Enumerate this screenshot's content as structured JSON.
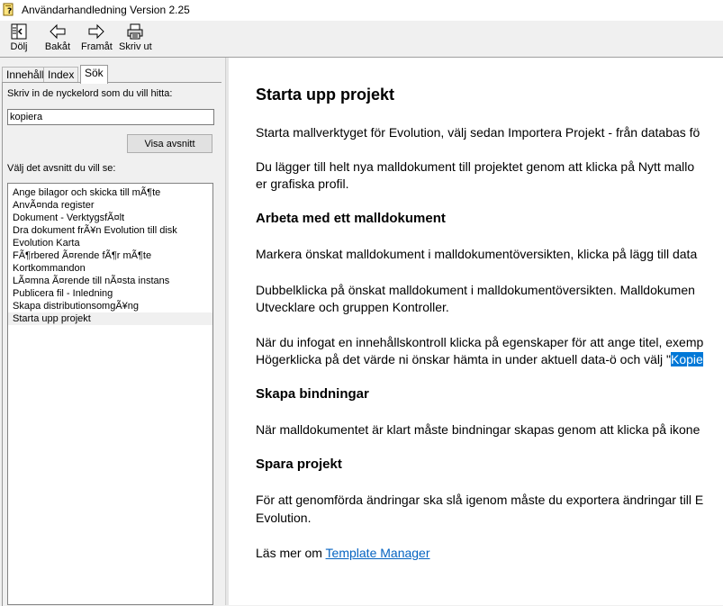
{
  "window": {
    "title": "Användarhandledning Version 2.25"
  },
  "toolbar": {
    "hide_label": "Dölj",
    "back_label": "Bakåt",
    "forward_label": "Framåt",
    "print_label": "Skriv ut"
  },
  "tabs": [
    {
      "label": "Innehåll"
    },
    {
      "label": "Index"
    },
    {
      "label": "Sök"
    }
  ],
  "search": {
    "prompt": "Skriv in de nyckelord som du vill hitta:",
    "value": "kopiera",
    "show_button": "Visa avsnitt",
    "select_prompt": "Välj det avsnitt du vill se:"
  },
  "topics": [
    "Ange bilagor och skicka till mÃ¶te",
    "AnvÃ¤nda register",
    "Dokument - VerktygsfÃ¤lt",
    "Dra dokument frÃ¥n Evolution till disk",
    "Evolution Karta",
    "FÃ¶rbered Ã¤rende fÃ¶r mÃ¶te",
    "Kortkommandon",
    "LÃ¤mna Ã¤rende till nÃ¤sta instans",
    "Publicera fil - Inledning",
    "Skapa distributionsomgÃ¥ng",
    "Starta upp projekt"
  ],
  "selected_topic": "Starta upp projekt",
  "article": {
    "title": "Starta upp projekt",
    "p1": "Starta mallverktyget för Evolution, välj sedan Importera Projekt - från databas fö",
    "p2a": "Du lägger till helt nya malldokument till projektet genom att klicka på Nytt mallo",
    "p2b": "er grafiska profil.",
    "h_arbeta": "Arbeta med ett malldokument",
    "p3": "Markera önskat malldokument i malldokumentöversikten, klicka på lägg till data",
    "p4a": "Dubbelklicka på önskat malldokument i malldokumentöversikten. Malldokumen",
    "p4b": "Utvecklare och gruppen Kontroller.",
    "p5a": "När du infogat en innehållskontroll klicka på egenskaper för att ange titel, exemp",
    "p5b_pre": "Högerklicka på det värde ni önskar hämta in under aktuell data-ö och välj \"",
    "p5b_hl": "Kopie",
    "h_bind": "Skapa bindningar",
    "p6": "När malldokumentet är klart måste bindningar skapas genom att klicka på ikone",
    "h_spara": "Spara projekt",
    "p7a": "För att genomförda ändringar ska slå igenom måste du exportera ändringar till E",
    "p7b": "Evolution.",
    "p8_pre": "Läs mer om ",
    "p8_link": "Template Manager"
  }
}
